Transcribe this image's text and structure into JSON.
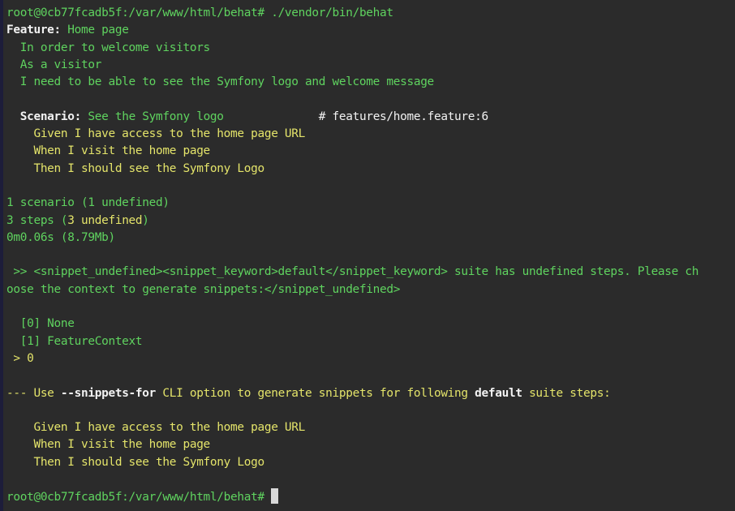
{
  "colors": {
    "background": "#2b2b2b",
    "green": "#5fd35f",
    "yellow": "#e4e46a",
    "white": "#f2f2f2"
  },
  "prompt": "root@0cb77fcadb5f:/var/www/html/behat#",
  "command": " ./vendor/bin/behat",
  "feature": {
    "keyword": "Feature:",
    "title": " Home page",
    "narrative": [
      "  In order to welcome visitors",
      "  As a visitor",
      "  I need to be able to see the Symfony logo and welcome message"
    ]
  },
  "scenario": {
    "keyword": "  Scenario:",
    "title": " See the Symfony logo",
    "padding": "              ",
    "source": "# features/home.feature:6",
    "steps": [
      "    Given I have access to the home page URL",
      "    When I visit the home page",
      "    Then I should see the Symfony Logo"
    ]
  },
  "summary": {
    "scenarios": "1 scenario (1 undefined)",
    "steps_prefix": "3 steps (",
    "steps_undefined": "3 undefined",
    "steps_suffix": ")",
    "time": "0m0.06s (8.79Mb)"
  },
  "snippet_question": {
    "line1": " >> <snippet_undefined><snippet_keyword>default</snippet_keyword> suite has undefined steps. Please ch",
    "line2": "oose the context to generate snippets:</snippet_undefined>"
  },
  "choices": [
    "  [0] None",
    "  [1] FeatureContext"
  ],
  "answer": " > 0",
  "usage": {
    "prefix": "--- Use ",
    "option": "--snippets-for",
    "middle": " CLI option to generate snippets for following ",
    "suite": "default",
    "suffix": " suite steps:"
  },
  "undefined_steps": [
    "    Given I have access to the home page URL",
    "    When I visit the home page",
    "    Then I should see the Symfony Logo"
  ],
  "final_prompt": "root@0cb77fcadb5f:/var/www/html/behat#"
}
